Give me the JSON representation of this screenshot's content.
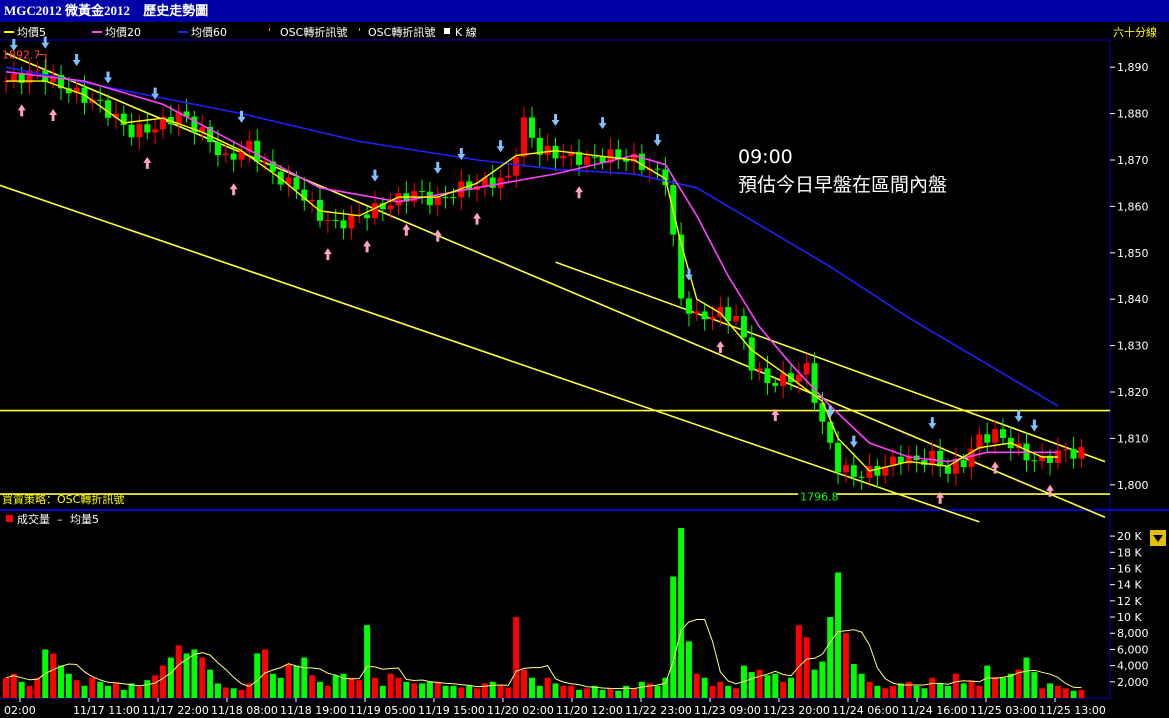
{
  "window": {
    "title_symbol": "MGC2012 微黃金2012",
    "title_view": "歷史走勢圖"
  },
  "legend_top": {
    "ma5": "均價5",
    "ma20": "均價20",
    "ma60": "均價60",
    "signal": "OSC轉折訊號",
    "signal2": "OSC轉折訊號",
    "kline": "K 線",
    "period": "六十分線"
  },
  "legend_bottom": {
    "volume": "成交量",
    "vol_ma": "均量5"
  },
  "strategy_label": "買賣策略：OSC轉折訊號",
  "annotation": {
    "time": "09:00",
    "text": "預估今日早盤在區間內盤"
  },
  "colors": {
    "up": "#ff0000",
    "down": "#00ff00",
    "ma5": "#ffff00",
    "ma20": "#ff40ff",
    "ma60": "#2020ff",
    "trend": "#ffff40",
    "buy_arrow": "#ffa0c0",
    "sell_arrow": "#80c0ff",
    "frame": "#0000c8"
  },
  "chart_data": {
    "type": "candlestick",
    "price_axis": {
      "min": 1795,
      "max": 1895,
      "ticks": [
        "1,800",
        "1,810",
        "1,820",
        "1,830",
        "1,840",
        "1,850",
        "1,860",
        "1,870",
        "1,880",
        "1,890"
      ]
    },
    "volume_axis": {
      "min": 0,
      "max": 21000,
      "ticks": [
        "2,000",
        "4,000",
        "6,000",
        "8,000",
        "10 K",
        "12 K",
        "14 K",
        "16 K",
        "18 K",
        "20 K"
      ]
    },
    "x_labels": [
      "02:00",
      "11/17 11:00",
      "11/17 22:00",
      "11/18 08:00",
      "11/18 19:00",
      "11/19 05:00",
      "11/19 15:00",
      "11/20 02:00",
      "11/20 12:00",
      "11/22 23:00",
      "11/23 09:00",
      "11/23 20:00",
      "11/24 06:00",
      "11/24 16:00",
      "11/25 03:00",
      "11/25 13:00"
    ],
    "high_marker": "1892.7",
    "low_marker": "1796.8",
    "horizontal_levels": [
      1816,
      1798
    ],
    "trendlines": [
      {
        "from": [
          0,
          1893
        ],
        "to": [
          140,
          1793
        ]
      },
      {
        "from": [
          -5,
          1867
        ],
        "to": [
          124,
          1792
        ]
      },
      {
        "from": [
          70,
          1848
        ],
        "to": [
          140,
          1805
        ]
      }
    ],
    "close_path": [
      [
        0,
        1887
      ],
      [
        4,
        1889
      ],
      [
        8,
        1885
      ],
      [
        12,
        1882
      ],
      [
        16,
        1876
      ],
      [
        19,
        1877
      ],
      [
        22,
        1880
      ],
      [
        25,
        1876
      ],
      [
        28,
        1870
      ],
      [
        31,
        1873
      ],
      [
        34,
        1867
      ],
      [
        37,
        1864
      ],
      [
        40,
        1858
      ],
      [
        42,
        1856
      ],
      [
        45,
        1858
      ],
      [
        48,
        1860
      ],
      [
        52,
        1863
      ],
      [
        55,
        1861
      ],
      [
        58,
        1864
      ],
      [
        61,
        1865
      ],
      [
        64,
        1866
      ],
      [
        66,
        1878
      ],
      [
        68,
        1872
      ],
      [
        71,
        1871
      ],
      [
        74,
        1870
      ],
      [
        77,
        1871
      ],
      [
        80,
        1870
      ],
      [
        82,
        1868
      ],
      [
        84,
        1866
      ],
      [
        86,
        1840
      ],
      [
        88,
        1836
      ],
      [
        91,
        1837
      ],
      [
        93,
        1836
      ],
      [
        95,
        1826
      ],
      [
        97,
        1822
      ],
      [
        100,
        1823
      ],
      [
        102,
        1825
      ],
      [
        104,
        1813
      ],
      [
        106,
        1804
      ],
      [
        108,
        1802
      ],
      [
        111,
        1803
      ],
      [
        114,
        1806
      ],
      [
        116,
        1805
      ],
      [
        118,
        1806
      ],
      [
        120,
        1803
      ],
      [
        122,
        1805
      ],
      [
        124,
        1810
      ],
      [
        126,
        1811
      ],
      [
        128,
        1809
      ],
      [
        130,
        1806
      ],
      [
        132,
        1805
      ],
      [
        134,
        1807
      ]
    ],
    "ma5": [
      [
        0,
        1887
      ],
      [
        5,
        1887
      ],
      [
        10,
        1884
      ],
      [
        15,
        1878
      ],
      [
        20,
        1879
      ],
      [
        25,
        1876
      ],
      [
        30,
        1872
      ],
      [
        35,
        1866
      ],
      [
        40,
        1859
      ],
      [
        45,
        1858
      ],
      [
        50,
        1862
      ],
      [
        55,
        1862
      ],
      [
        60,
        1865
      ],
      [
        65,
        1871
      ],
      [
        70,
        1872
      ],
      [
        75,
        1871
      ],
      [
        80,
        1870
      ],
      [
        84,
        1866
      ],
      [
        86,
        1852
      ],
      [
        88,
        1840
      ],
      [
        91,
        1837
      ],
      [
        95,
        1829
      ],
      [
        100,
        1823
      ],
      [
        104,
        1818
      ],
      [
        106,
        1810
      ],
      [
        110,
        1803
      ],
      [
        115,
        1805
      ],
      [
        120,
        1804
      ],
      [
        124,
        1808
      ],
      [
        128,
        1809
      ],
      [
        132,
        1806
      ],
      [
        134,
        1806
      ]
    ],
    "ma20": [
      [
        0,
        1889
      ],
      [
        10,
        1887
      ],
      [
        20,
        1882
      ],
      [
        30,
        1873
      ],
      [
        40,
        1864
      ],
      [
        50,
        1861
      ],
      [
        60,
        1864
      ],
      [
        70,
        1867
      ],
      [
        80,
        1871
      ],
      [
        84,
        1869
      ],
      [
        88,
        1858
      ],
      [
        92,
        1845
      ],
      [
        96,
        1834
      ],
      [
        100,
        1826
      ],
      [
        105,
        1817
      ],
      [
        110,
        1809
      ],
      [
        115,
        1806
      ],
      [
        120,
        1805
      ],
      [
        125,
        1807
      ],
      [
        130,
        1807
      ],
      [
        134,
        1807
      ]
    ],
    "ma60": [
      [
        0,
        1890
      ],
      [
        15,
        1885
      ],
      [
        30,
        1880
      ],
      [
        45,
        1874
      ],
      [
        60,
        1870
      ],
      [
        70,
        1868
      ],
      [
        80,
        1867
      ],
      [
        88,
        1864
      ],
      [
        95,
        1857
      ],
      [
        105,
        1847
      ],
      [
        115,
        1836
      ],
      [
        125,
        1826
      ],
      [
        134,
        1817
      ]
    ],
    "volume": [
      2500,
      3000,
      2000,
      1500,
      2500,
      6000,
      5500,
      4000,
      3000,
      2200,
      1500,
      2500,
      2000,
      1500,
      1800,
      1000,
      1800,
      1400,
      2200,
      2800,
      4000,
      5000,
      6500,
      5500,
      6000,
      5000,
      3500,
      1800,
      1300,
      1200,
      1000,
      1800,
      5500,
      6000,
      3000,
      2500,
      4200,
      4000,
      5000,
      2800,
      2000,
      1500,
      2800,
      3000,
      2500,
      2200,
      9000,
      2500,
      1500,
      3000,
      2500,
      2000,
      1800,
      1800,
      2000,
      2000,
      1500,
      1500,
      1300,
      1500,
      1200,
      1800,
      2000,
      1500,
      1300,
      10000,
      3500,
      2500,
      1500,
      2500,
      1800,
      1500,
      1500,
      1000,
      1200,
      1500,
      1000,
      1200,
      900,
      1500,
      1200,
      2000,
      1800,
      1500,
      2500,
      15000,
      21000,
      7000,
      3000,
      2500,
      1500,
      2000,
      1500,
      1200,
      4000,
      3200,
      3500,
      2800,
      3000,
      2000,
      2500,
      9000,
      7500,
      3500,
      4500,
      10000,
      15500,
      8000,
      4200,
      3000,
      2000,
      1500,
      1200,
      1500,
      1800,
      2000,
      1500,
      1200,
      2500,
      1800,
      1500,
      3000,
      1800,
      2200,
      1500,
      4000,
      2600,
      2500,
      3000,
      3500,
      5000,
      3200,
      1200,
      1800,
      1500,
      1200,
      900,
      1000
    ],
    "buy_signals": [
      2,
      6,
      18,
      29,
      41,
      46,
      51,
      55,
      60,
      73,
      91,
      98,
      119,
      126,
      133
    ],
    "sell_signals": [
      1,
      5,
      9,
      13,
      19,
      30,
      47,
      55,
      58,
      63,
      70,
      76,
      83,
      87,
      105,
      108,
      118,
      129,
      131
    ]
  }
}
